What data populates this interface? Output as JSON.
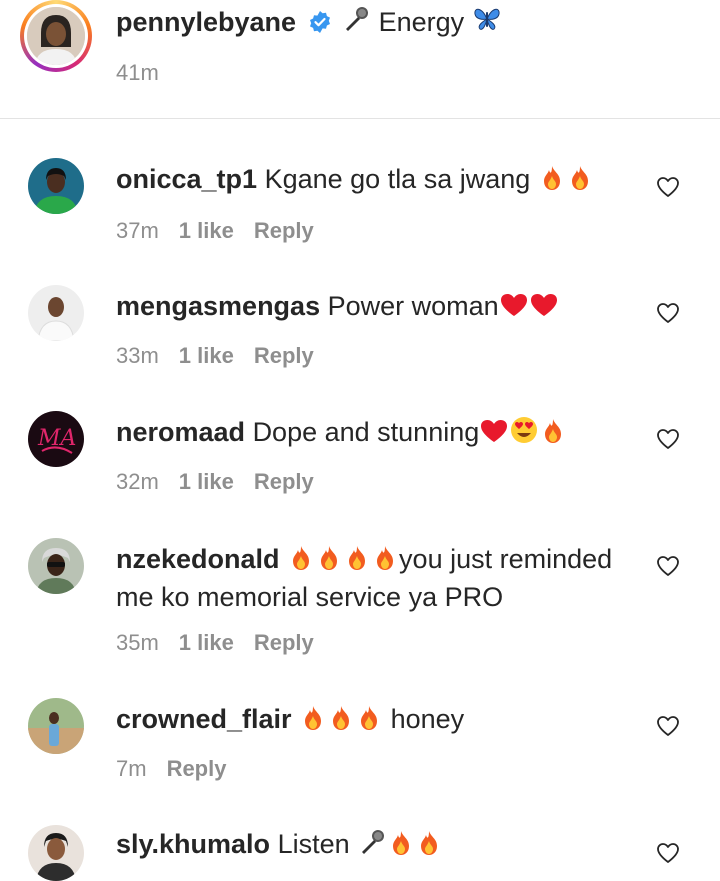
{
  "post": {
    "username": "pennylebyane",
    "caption_text": "Energy",
    "time": "41m"
  },
  "comments": [
    {
      "username": "onicca_tp1",
      "text": "Kgane go tla sa jwang",
      "emoji_after": [
        "fire",
        "fire"
      ],
      "time": "37m",
      "likes": "1 like",
      "reply": "Reply"
    },
    {
      "username": "mengasmengas",
      "text": "Power woman",
      "emoji_after": [
        "red-heart",
        "red-heart"
      ],
      "time": "33m",
      "likes": "1 like",
      "reply": "Reply"
    },
    {
      "username": "neromaad",
      "text": "Dope and stunning",
      "emoji_after": [
        "red-heart",
        "heart-eyes",
        "fire"
      ],
      "time": "32m",
      "likes": "1 like",
      "reply": "Reply"
    },
    {
      "username": "nzekedonald",
      "text_line1": "you just reminded",
      "text_line2": "me ko memorial service ya PRO",
      "emoji_before": [
        "fire",
        "fire",
        "fire",
        "fire"
      ],
      "time": "35m",
      "likes": "1 like",
      "reply": "Reply"
    },
    {
      "username": "crowned_flair",
      "text": "honey",
      "emoji_before": [
        "fire",
        "fire",
        "fire"
      ],
      "time": "7m",
      "reply": "Reply"
    },
    {
      "username": "sly.khumalo",
      "text": "Listen",
      "emoji_after": [
        "microphone",
        "fire",
        "fire"
      ]
    }
  ],
  "icons": {
    "verified": "verified-badge-icon",
    "like": "heart-outline-icon",
    "microphone": "microphone-emoji",
    "butterfly": "butterfly-emoji"
  },
  "colors": {
    "username": "#262626",
    "meta": "#8e8e8e",
    "verified": "#3897f0",
    "divider": "#e3e3e3"
  }
}
